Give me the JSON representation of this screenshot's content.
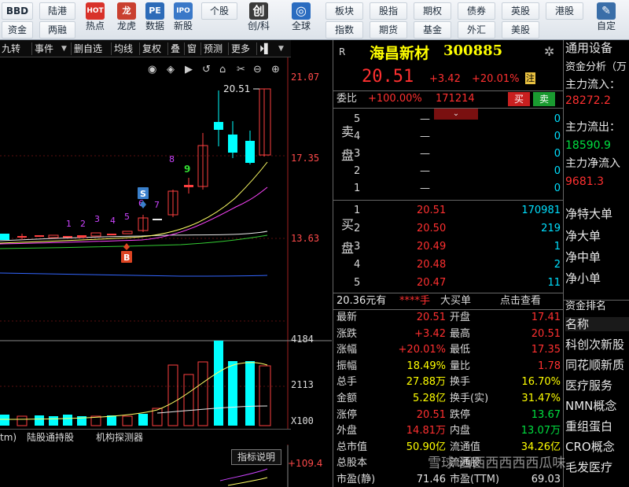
{
  "toolbar": {
    "row1_buttons": [
      "BBD",
      "陆港",
      "个股",
      "板块",
      "股指",
      "期权",
      "债券",
      "英股",
      "港股"
    ],
    "row2_buttons": [
      "资金",
      "两融",
      "指数",
      "期货",
      "基金",
      "外汇",
      "美股"
    ],
    "icons": [
      {
        "name": "hotspot-icon",
        "glyph": "HOT",
        "label": "热点",
        "color": "#d8322a"
      },
      {
        "name": "dragon-tiger-icon",
        "glyph": "龙",
        "label": "龙虎",
        "color": "#c94030"
      },
      {
        "name": "data-icon",
        "glyph": "PE",
        "label": "数据",
        "color": "#2d6bb8"
      },
      {
        "name": "ipo-icon",
        "glyph": "IPO",
        "label": "新股",
        "color": "#3a78c8"
      },
      {
        "name": "star-market-icon",
        "glyph": "创",
        "label": "创/科",
        "color": "#3a3a3a"
      },
      {
        "name": "globe-icon",
        "glyph": "◎",
        "label": "全球",
        "color": "#2a6cc0"
      },
      {
        "name": "customize-icon",
        "glyph": "✎",
        "label": "自定",
        "color": "#3a6ea8"
      }
    ]
  },
  "chart": {
    "tabs": [
      "九转",
      "事件",
      "删自选",
      "均线",
      "复权",
      "叠",
      "窗",
      "预测",
      "更多"
    ],
    "y_labels": [
      "21.07",
      "17.35",
      "13.63"
    ],
    "max_label": "20.51",
    "vol_labels": [
      "4184",
      "2113",
      "X100"
    ],
    "sub_tabs": [
      "tm)",
      "陆股通持股",
      "机构探测器"
    ],
    "indicator_button": "指标说明",
    "bottom_value": "+109.4",
    "td_numbers_low": [
      "1",
      "2",
      "3",
      "4",
      "5",
      "6",
      "7"
    ],
    "td_numbers_high": [
      "8",
      "9"
    ],
    "signal_s": "S",
    "signal_b": "B"
  },
  "quote": {
    "market_tag": "R",
    "stock_name": "海昌新材",
    "stock_code": "300885",
    "price": "20.51",
    "change": "+3.42",
    "change_pct": "+20.01%",
    "limit_tag": "注",
    "weibi_label": "委比",
    "weibi_value": "+100.00%",
    "weicha_value": "171214",
    "buy_btn": "买",
    "sell_btn": "卖",
    "sell_side_label": "卖盘",
    "buy_side_label": "买盘",
    "sells": [
      {
        "level": "5",
        "price": "—",
        "vol": "0"
      },
      {
        "level": "4",
        "price": "—",
        "vol": "0"
      },
      {
        "level": "3",
        "price": "—",
        "vol": "0"
      },
      {
        "level": "2",
        "price": "—",
        "vol": "0"
      },
      {
        "level": "1",
        "price": "—",
        "vol": "0"
      }
    ],
    "buys": [
      {
        "level": "1",
        "price": "20.51",
        "vol": "170981"
      },
      {
        "level": "2",
        "price": "20.50",
        "vol": "219"
      },
      {
        "level": "3",
        "price": "20.49",
        "vol": "1"
      },
      {
        "level": "4",
        "price": "20.48",
        "vol": "2"
      },
      {
        "level": "5",
        "price": "20.47",
        "vol": "11"
      }
    ],
    "big_order_price": "20.36元有",
    "big_order_stars": "****手",
    "big_order_label": "大买单",
    "big_order_link": "点击查看",
    "stats": [
      {
        "l": "最新",
        "v": "20.51",
        "vc": "red",
        "l2": "开盘",
        "v2": "17.41",
        "v2c": "red"
      },
      {
        "l": "涨跌",
        "v": "+3.42",
        "vc": "red",
        "l2": "最高",
        "v2": "20.51",
        "v2c": "red"
      },
      {
        "l": "涨幅",
        "v": "+20.01%",
        "vc": "red",
        "l2": "最低",
        "v2": "17.35",
        "v2c": "red"
      },
      {
        "l": "振幅",
        "v": "18.49%",
        "vc": "yel",
        "l2": "量比",
        "v2": "1.78",
        "v2c": "red"
      },
      {
        "l": "总手",
        "v": "27.88万",
        "vc": "yel",
        "l2": "换手",
        "v2": "16.70%",
        "v2c": "yel"
      },
      {
        "l": "金额",
        "v": "5.28亿",
        "vc": "yel",
        "l2": "换手(实)",
        "v2": "31.47%",
        "v2c": "yel"
      },
      {
        "l": "涨停",
        "v": "20.51",
        "vc": "red",
        "l2": "跌停",
        "v2": "13.67",
        "v2c": "grn"
      },
      {
        "l": "外盘",
        "v": "14.81万",
        "vc": "red",
        "l2": "内盘",
        "v2": "13.07万",
        "v2c": "grn"
      },
      {
        "l": "总市值",
        "v": "50.90亿",
        "vc": "yel",
        "l2": "流通值",
        "v2": "34.26亿",
        "v2c": "yel"
      },
      {
        "l": "总股本",
        "v": "",
        "vc": "yel",
        "l2": "流通股",
        "v2": "",
        "v2c": "yel"
      },
      {
        "l": "市盈(静)",
        "v": "71.46",
        "vc": "wht",
        "l2": "市盈(TTM)",
        "v2": "69.03",
        "v2c": "wht"
      }
    ]
  },
  "right_panel": {
    "title": "通用设备",
    "fund_analysis": "资金分析（万",
    "inflow_label": "主力流入：",
    "inflow_value": "28272.2",
    "outflow_label": "主力流出：",
    "outflow_value": "18590.9",
    "net_label": "主力净流入",
    "net_value": "9681.3",
    "items": [
      "净特大单",
      "净大单",
      "净中单",
      "净小单"
    ],
    "rank_title": "资金排名",
    "rank_header": "名称",
    "concepts": [
      "科创次新股",
      "同花顺新质",
      "医疗服务",
      "NMN概念",
      "重组蛋白",
      "CRO概念",
      "毛发医疗"
    ]
  },
  "watermark": "雪球 西西西西西西瓜味"
}
